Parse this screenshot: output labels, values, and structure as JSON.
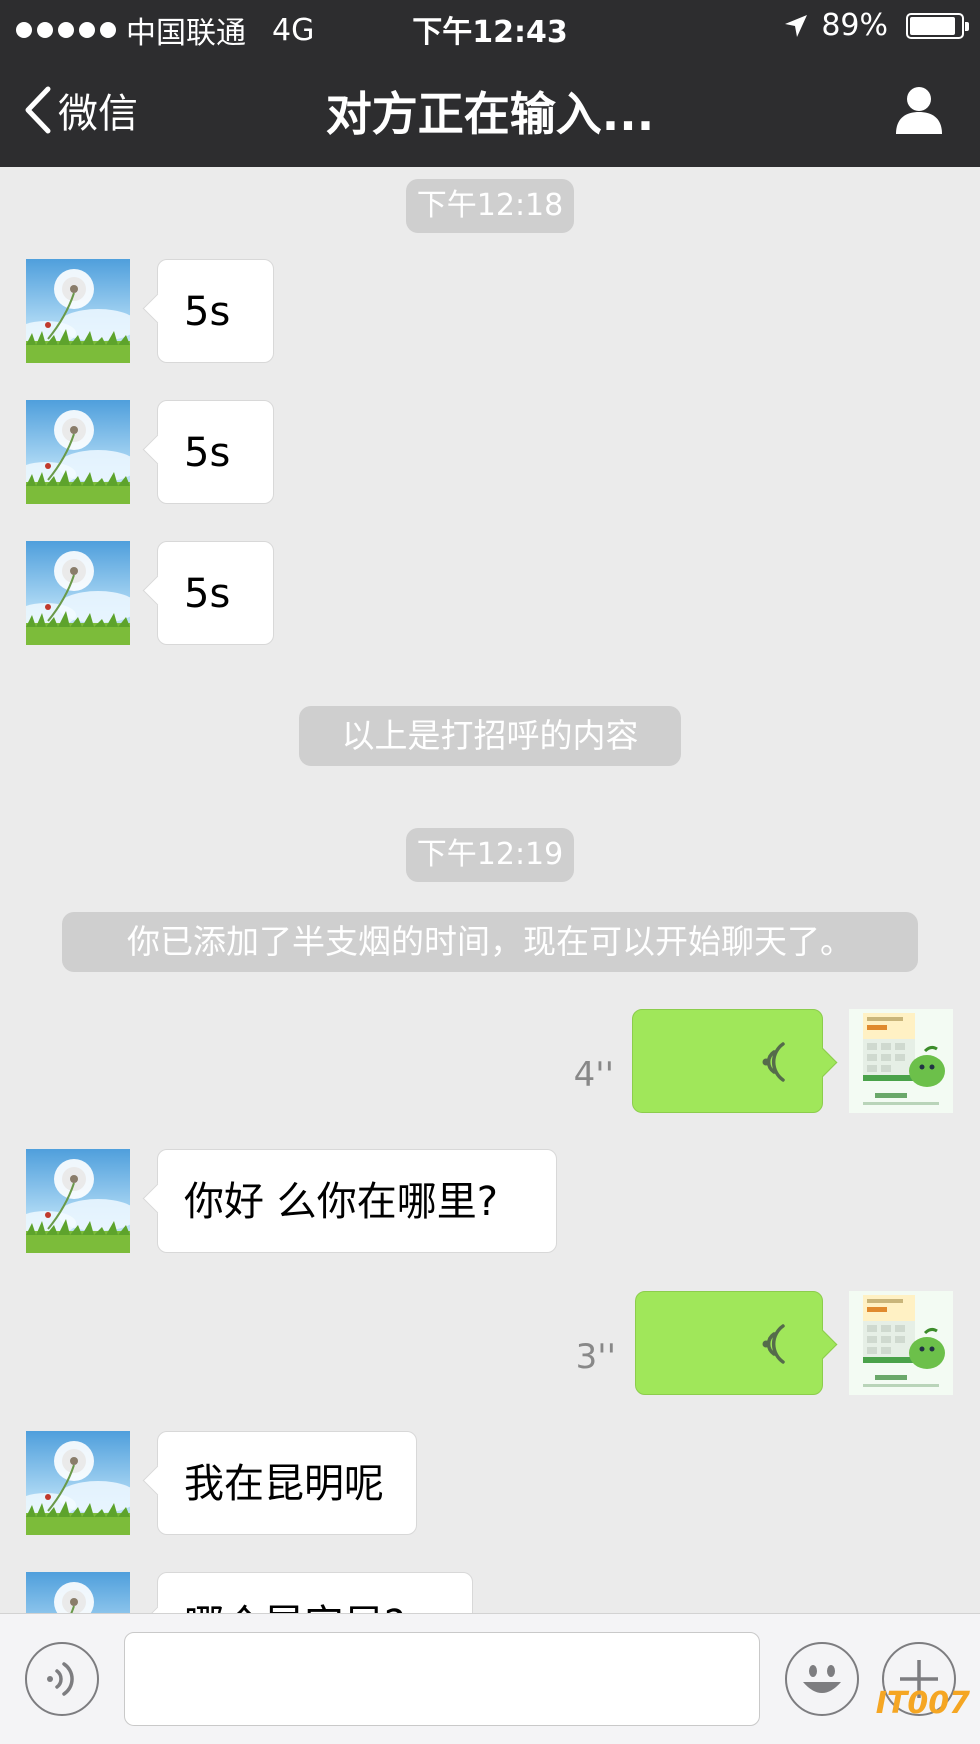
{
  "status_bar": {
    "carrier": "中国联通",
    "network": "4G",
    "time": "下午12:43",
    "battery": "89%",
    "battery_level": 0.89
  },
  "nav": {
    "back_label": "微信",
    "title": "对方正在输入...",
    "back_icon": "chevron-left-icon",
    "profile_icon": "person-icon"
  },
  "messages": {
    "time1": "下午12:18",
    "m1": "5s",
    "m2": "5s",
    "m3": "5s",
    "system1": "以上是打招呼的内容",
    "time2": "下午12:19",
    "system2": "你已添加了半支烟的时间，现在可以开始聊天了。",
    "voice1_duration": "4''",
    "m4": "你好 么你在哪里?",
    "voice2_duration": "3''",
    "m5": "我在昆明呢",
    "m6": "哪个昆安早?"
  },
  "input_bar": {
    "voice_icon": "voice-icon",
    "emoji_icon": "emoji-icon",
    "plus_icon": "plus-icon"
  },
  "watermark": "IT007",
  "colors": {
    "bar": "#2d2d2f",
    "chat_bg": "#ebebeb",
    "voice_bubble": "#a0e75a"
  }
}
